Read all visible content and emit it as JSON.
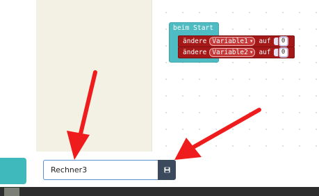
{
  "editor": {
    "start_block": {
      "label": "beim Start",
      "color": "#4ebcc2"
    },
    "set_blocks": [
      {
        "keyword": "ändere",
        "variable": "Variable1",
        "to_label": "auf",
        "value": "0"
      },
      {
        "keyword": "ändere",
        "variable": "Variable2",
        "to_label": "auf",
        "value": "0"
      }
    ],
    "variable_color": "#a41818"
  },
  "project_name": {
    "value": "Rechner3"
  },
  "save_button": {
    "icon": "save-icon"
  },
  "annotations": {
    "arrow_color": "#ee1c1c",
    "arrow_count": 2
  }
}
